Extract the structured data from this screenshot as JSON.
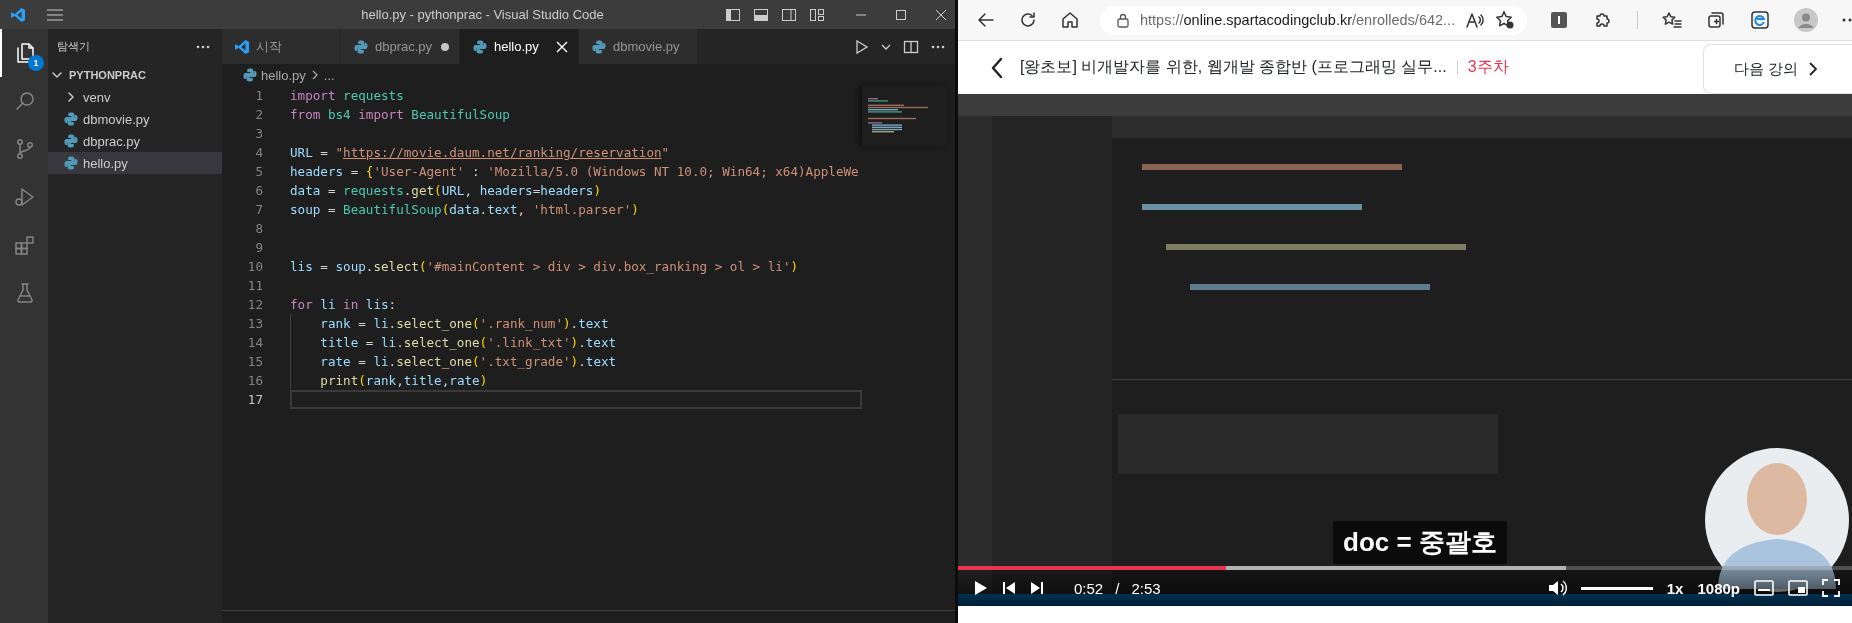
{
  "vscode": {
    "window": {
      "title": "hello.py - pythonprac - Visual Studio Code"
    },
    "activity_bar": [
      {
        "kind": "explorer",
        "selected": true,
        "badge": "1"
      },
      {
        "kind": "search",
        "selected": false
      },
      {
        "kind": "source-control",
        "selected": false
      },
      {
        "kind": "run-debug",
        "selected": false
      },
      {
        "kind": "extensions",
        "selected": false
      },
      {
        "kind": "testing",
        "selected": false
      }
    ],
    "sidebar": {
      "title": "탐색기",
      "tree": [
        {
          "label": "PYTHONPRAC",
          "kind": "folder",
          "expanded": true,
          "selected": false,
          "children": [
            {
              "label": "venv",
              "kind": "folder",
              "expanded": false,
              "selected": false
            },
            {
              "label": "dbmovie.py",
              "kind": "python",
              "selected": false
            },
            {
              "label": "dbprac.py",
              "kind": "python",
              "selected": false
            },
            {
              "label": "hello.py",
              "kind": "python",
              "selected": true
            }
          ]
        }
      ]
    },
    "tabs": [
      {
        "label": "시작",
        "kind": "welcome",
        "selected": false,
        "modified": false
      },
      {
        "label": "dbprac.py",
        "kind": "python",
        "selected": false,
        "modified": true
      },
      {
        "label": "hello.py",
        "kind": "python",
        "selected": true,
        "modified": false
      },
      {
        "label": "dbmovie.py",
        "kind": "python",
        "selected": false,
        "modified": false
      }
    ],
    "breadcrumb": [
      "hello.py",
      "..."
    ],
    "code": [
      {
        "number": "1",
        "current": false,
        "tokens": [
          {
            "text": "import",
            "kind": "kw"
          },
          {
            "text": " requests",
            "kind": "mod"
          }
        ]
      },
      {
        "number": "2",
        "current": false,
        "tokens": [
          {
            "text": "from",
            "kind": "kw"
          },
          {
            "text": " bs4",
            "kind": "mod"
          },
          {
            "text": " import",
            "kind": "kw"
          },
          {
            "text": " BeautifulSoup",
            "kind": "mod"
          }
        ]
      },
      {
        "number": "3",
        "current": false
      },
      {
        "number": "4",
        "current": false,
        "tokens": [
          {
            "text": "URL",
            "kind": "var"
          },
          {
            "text": " = ",
            "kind": "op"
          },
          {
            "text": "\"",
            "kind": "str"
          },
          {
            "text": "https://movie.daum.net/ranking/reservation",
            "kind": "link"
          },
          {
            "text": "\"",
            "kind": "str"
          }
        ]
      },
      {
        "number": "5",
        "current": false,
        "tokens": [
          {
            "text": "headers",
            "kind": "var"
          },
          {
            "text": " = ",
            "kind": "op"
          },
          {
            "text": "{",
            "kind": "br"
          },
          {
            "text": "'User-Agent'",
            "kind": "str"
          },
          {
            "text": " : ",
            "kind": "op"
          },
          {
            "text": "'Mozilla/5.0 (Windows NT 10.0; Win64; x64)AppleWe",
            "kind": "str"
          }
        ]
      },
      {
        "number": "6",
        "current": false,
        "tokens": [
          {
            "text": "data",
            "kind": "var"
          },
          {
            "text": " = ",
            "kind": "op"
          },
          {
            "text": "requests",
            "kind": "mod"
          },
          {
            "text": ".",
            "kind": "op"
          },
          {
            "text": "get",
            "kind": "fn"
          },
          {
            "text": "(",
            "kind": "br"
          },
          {
            "text": "URL",
            "kind": "var"
          },
          {
            "text": ", ",
            "kind": "op"
          },
          {
            "text": "headers",
            "kind": "var"
          },
          {
            "text": "=",
            "kind": "op"
          },
          {
            "text": "headers",
            "kind": "var"
          },
          {
            "text": ")",
            "kind": "br"
          }
        ]
      },
      {
        "number": "7",
        "current": false,
        "tokens": [
          {
            "text": "soup",
            "kind": "var"
          },
          {
            "text": " = ",
            "kind": "op"
          },
          {
            "text": "BeautifulSoup",
            "kind": "mod"
          },
          {
            "text": "(",
            "kind": "br"
          },
          {
            "text": "data",
            "kind": "var"
          },
          {
            "text": ".",
            "kind": "op"
          },
          {
            "text": "text",
            "kind": "var"
          },
          {
            "text": ", ",
            "kind": "op"
          },
          {
            "text": "'html.parser'",
            "kind": "str"
          },
          {
            "text": ")",
            "kind": "br"
          }
        ]
      },
      {
        "number": "8",
        "current": false
      },
      {
        "number": "9",
        "current": false
      },
      {
        "number": "10",
        "current": false,
        "tokens": [
          {
            "text": "lis",
            "kind": "var"
          },
          {
            "text": " = ",
            "kind": "op"
          },
          {
            "text": "soup",
            "kind": "var"
          },
          {
            "text": ".",
            "kind": "op"
          },
          {
            "text": "select",
            "kind": "fn"
          },
          {
            "text": "(",
            "kind": "br"
          },
          {
            "text": "'#mainContent > div > div.box_ranking > ol > li'",
            "kind": "str"
          },
          {
            "text": ")",
            "kind": "br"
          }
        ]
      },
      {
        "number": "11",
        "current": false
      },
      {
        "number": "12",
        "current": false,
        "tokens": [
          {
            "text": "for",
            "kind": "kw"
          },
          {
            "text": " li",
            "kind": "var"
          },
          {
            "text": " in",
            "kind": "kw"
          },
          {
            "text": " lis",
            "kind": "var"
          },
          {
            "text": ":",
            "kind": "op"
          }
        ],
        "children": [
          {
            "number": "13",
            "current": false,
            "tokens": [
              {
                "text": "rank",
                "kind": "var"
              },
              {
                "text": " = ",
                "kind": "op"
              },
              {
                "text": "li",
                "kind": "var"
              },
              {
                "text": ".",
                "kind": "op"
              },
              {
                "text": "select_one",
                "kind": "fn"
              },
              {
                "text": "(",
                "kind": "br"
              },
              {
                "text": "'.rank_num'",
                "kind": "str"
              },
              {
                "text": ")",
                "kind": "br"
              },
              {
                "text": ".",
                "kind": "op"
              },
              {
                "text": "text",
                "kind": "var"
              }
            ]
          },
          {
            "number": "14",
            "current": false,
            "tokens": [
              {
                "text": "title",
                "kind": "var"
              },
              {
                "text": " = ",
                "kind": "op"
              },
              {
                "text": "li",
                "kind": "var"
              },
              {
                "text": ".",
                "kind": "op"
              },
              {
                "text": "select_one",
                "kind": "fn"
              },
              {
                "text": "(",
                "kind": "br"
              },
              {
                "text": "'.link_txt'",
                "kind": "str"
              },
              {
                "text": ")",
                "kind": "br"
              },
              {
                "text": ".",
                "kind": "op"
              },
              {
                "text": "text",
                "kind": "var"
              }
            ]
          },
          {
            "number": "15",
            "current": false,
            "tokens": [
              {
                "text": "rate",
                "kind": "var"
              },
              {
                "text": " = ",
                "kind": "op"
              },
              {
                "text": "li",
                "kind": "var"
              },
              {
                "text": ".",
                "kind": "op"
              },
              {
                "text": "select_one",
                "kind": "fn"
              },
              {
                "text": "(",
                "kind": "br"
              },
              {
                "text": "'.txt_grade'",
                "kind": "str"
              },
              {
                "text": ")",
                "kind": "br"
              },
              {
                "text": ".",
                "kind": "op"
              },
              {
                "text": "text",
                "kind": "var"
              }
            ]
          },
          {
            "number": "16",
            "current": false,
            "tokens": [
              {
                "text": "print",
                "kind": "fn"
              },
              {
                "text": "(",
                "kind": "br"
              },
              {
                "text": "rank",
                "kind": "var"
              },
              {
                "text": ",",
                "kind": "op"
              },
              {
                "text": "title",
                "kind": "var"
              },
              {
                "text": ",",
                "kind": "op"
              },
              {
                "text": "rate",
                "kind": "var"
              },
              {
                "text": ")",
                "kind": "br"
              }
            ]
          }
        ]
      },
      {
        "number": "17",
        "current": true
      }
    ]
  },
  "browser": {
    "address": {
      "scheme": "https://",
      "host": "online.spartacodingclub.kr",
      "path": "/enrolleds/642..."
    },
    "course": {
      "title": "[왕초보] 비개발자를 위한, 웹개발 종합반 (프로그래밍 실무...",
      "week": "3주차",
      "next_button": "다음 강의"
    },
    "video": {
      "kind": "picture",
      "subtitle": "doc = 중괄호",
      "progress": {
        "level": 0.3
      },
      "buffered": {
        "level": 0.68
      },
      "current_time": "0:52",
      "separator": "/",
      "duration": "2:53",
      "volume": {
        "level": 1
      },
      "speed": "1x",
      "quality": "1080p"
    }
  }
}
